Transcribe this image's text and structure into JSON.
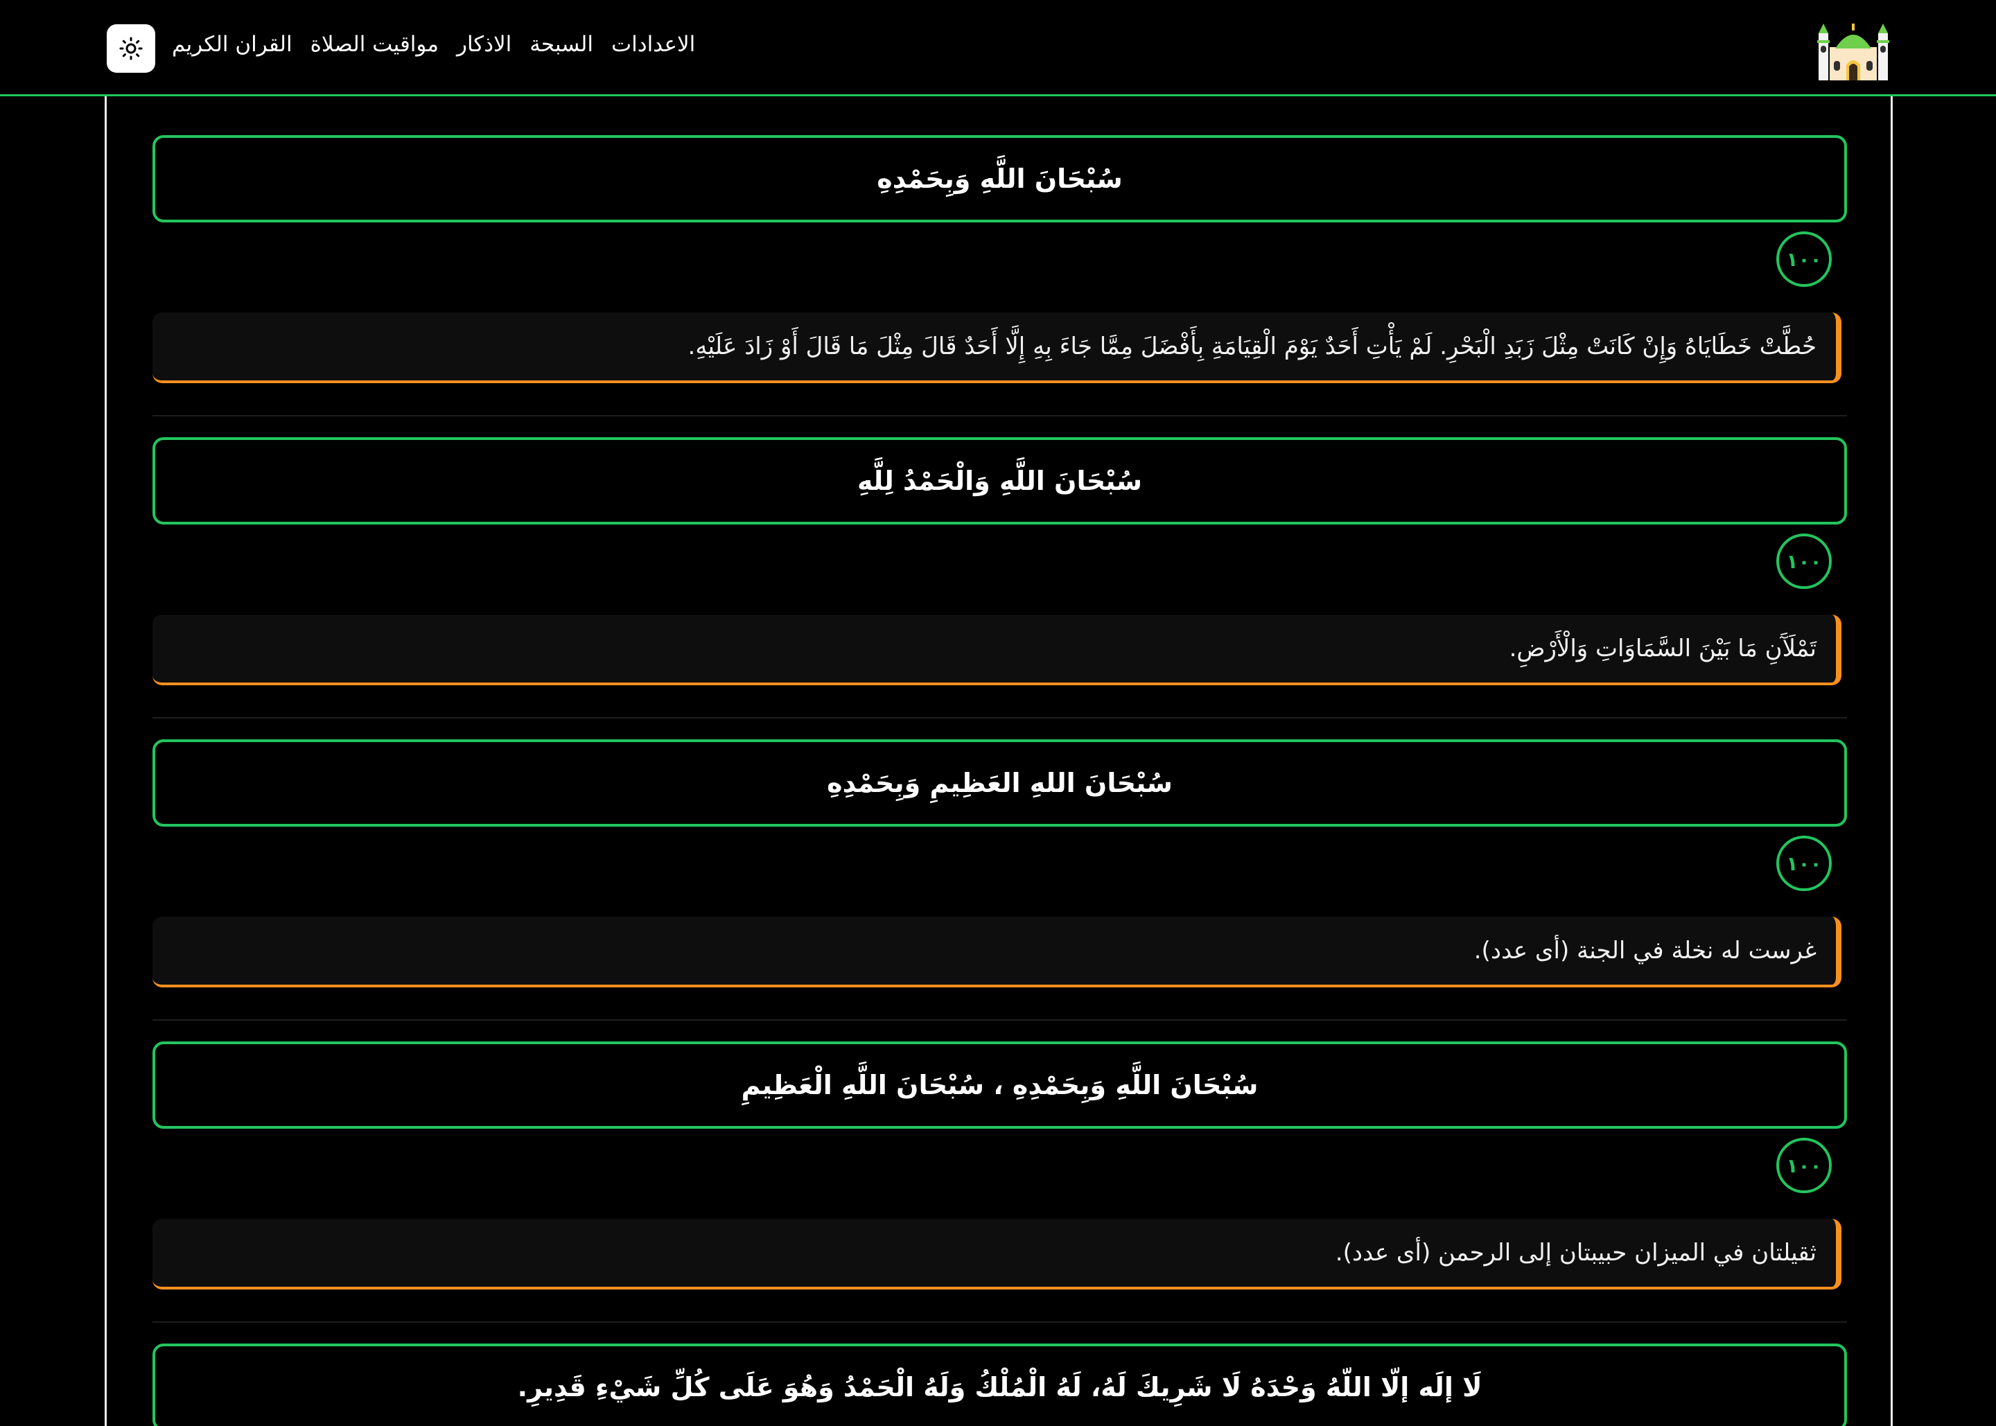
{
  "navbar": {
    "links": [
      "القران الكريم",
      "مواقيت الصلاة",
      "الاذكار",
      "السبحة",
      "الاعدادات"
    ],
    "theme_icon": "sun-icon",
    "logo_icon": "mosque-icon"
  },
  "colors": {
    "accent": "#22c55e",
    "virtue_border": "#f7901e",
    "background": "#000000"
  },
  "azkar": [
    {
      "text": "سُبْحَانَ اللَّهِ وَبِحَمْدِهِ",
      "count": "١٠٠",
      "virtue": "حُطَّتْ خَطَايَاهُ وَإِنْ كَانَتْ مِثْلَ زَبَدِ الْبَحْرِ. لَمْ يَأْتِ أَحَدٌ يَوْمَ الْقِيَامَةِ بِأَفْضَلَ مِمَّا جَاءَ بِهِ إِلَّا أَحَدٌ قَالَ مِثْلَ مَا قَالَ أَوْ زَادَ عَلَيْهِ."
    },
    {
      "text": "سُبْحَانَ اللَّهِ وَالْحَمْدُ لِلَّهِ",
      "count": "١٠٠",
      "virtue": "تَمْلَآَنِ مَا بَيْنَ السَّمَاوَاتِ وَالْأَرْضِ."
    },
    {
      "text": "سُبْحَانَ اللهِ العَظِيمِ وَبِحَمْدِهِ",
      "count": "١٠٠",
      "virtue": "غرست له نخلة في الجنة (أى عدد)."
    },
    {
      "text": "سُبْحَانَ اللَّهِ وَبِحَمْدِهِ ، سُبْحَانَ اللَّهِ الْعَظِيمِ",
      "count": "١٠٠",
      "virtue": "ثقيلتان في الميزان حبيبتان إلى الرحمن (أى عدد)."
    },
    {
      "text": "لَا إلَه إلّا اللّهُ وَحْدَهُ لَا شَرِيكَ لَهُ، لَهُ الْمُلْكُ وَلَهُ الْحَمْدُ وَهُوَ عَلَى كُلِّ شَيْءِ قَدِيرِ."
    }
  ]
}
